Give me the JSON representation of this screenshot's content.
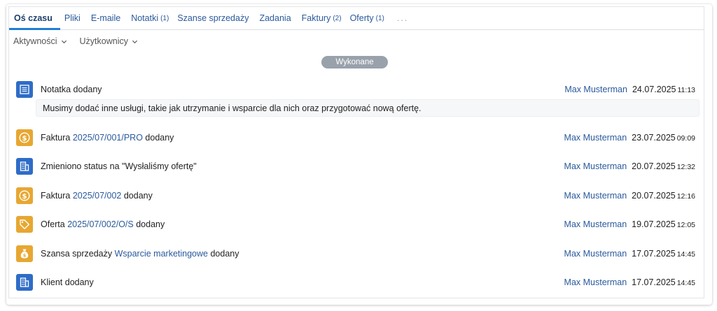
{
  "tabs": [
    {
      "label": "Oś czasu",
      "count": ""
    },
    {
      "label": "Pliki",
      "count": ""
    },
    {
      "label": "E-maile",
      "count": ""
    },
    {
      "label": "Notatki",
      "count": "(1)"
    },
    {
      "label": "Szanse sprzedaży",
      "count": ""
    },
    {
      "label": "Zadania",
      "count": ""
    },
    {
      "label": "Faktury",
      "count": "(2)"
    },
    {
      "label": "Oferty",
      "count": "(1)"
    },
    {
      "label": "...",
      "count": ""
    }
  ],
  "filters": {
    "activities": "Aktywności",
    "users": "Użytkownicy"
  },
  "status_badge": "Wykonane",
  "colors": {
    "accent": "#1f7ed4",
    "link": "#2a5a9c",
    "icon_blue": "#2e6cc7",
    "icon_gold": "#e7a731",
    "badge": "#99a1ab"
  },
  "timeline": [
    {
      "icon": "note-icon",
      "icon_color": "blue",
      "prefix": "Notatka dodany",
      "link": "",
      "suffix": "",
      "user": "Max Musterman",
      "date": "24.07.2025",
      "time": "11:13",
      "note": "Musimy dodać inne usługi, takie jak utrzymanie i wsparcie dla nich oraz przygotować nową ofertę."
    },
    {
      "icon": "dollar-coin-icon",
      "icon_color": "gold",
      "prefix": "Faktura ",
      "link": "2025/07/001/PRO",
      "suffix": " dodany",
      "user": "Max Musterman",
      "date": "23.07.2025",
      "time": "09:09"
    },
    {
      "icon": "building-icon",
      "icon_color": "blue",
      "prefix": "Zmieniono status na \"Wysłaliśmy ofertę\"",
      "link": "",
      "suffix": "",
      "user": "Max Musterman",
      "date": "20.07.2025",
      "time": "12:32"
    },
    {
      "icon": "dollar-coin-icon",
      "icon_color": "gold",
      "prefix": "Faktura ",
      "link": "2025/07/002",
      "suffix": " dodany",
      "user": "Max Musterman",
      "date": "20.07.2025",
      "time": "12:16"
    },
    {
      "icon": "price-tag-icon",
      "icon_color": "gold",
      "prefix": "Oferta ",
      "link": "2025/07/002/O/S",
      "suffix": " dodany",
      "user": "Max Musterman",
      "date": "19.07.2025",
      "time": "12:05"
    },
    {
      "icon": "money-bag-icon",
      "icon_color": "gold",
      "prefix": "Szansa sprzedaży ",
      "link": "Wsparcie marketingowe",
      "suffix": " dodany",
      "user": "Max Musterman",
      "date": "17.07.2025",
      "time": "14:45"
    },
    {
      "icon": "building-icon",
      "icon_color": "blue",
      "prefix": "Klient dodany",
      "link": "",
      "suffix": "",
      "user": "Max Musterman",
      "date": "17.07.2025",
      "time": "14:45"
    }
  ]
}
